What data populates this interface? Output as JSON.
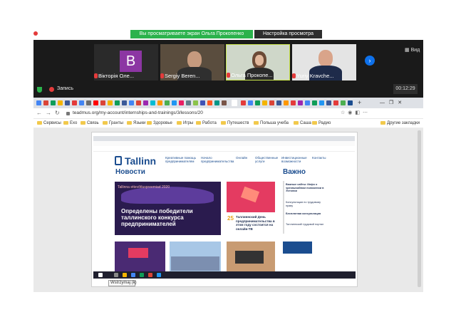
{
  "zoom": {
    "share_banner": "Вы просматриваете экран Ольга Прокопенко",
    "view_options": "Настройка просмотра",
    "participants": [
      {
        "avatar_letter": "B",
        "name": "Вікторія Оле..."
      },
      {
        "name": "Sergiy Beren..."
      },
      {
        "name": "Ольга Прокопе..."
      },
      {
        "name": "Yuriy Kravche..."
      }
    ],
    "view_label": "Вид",
    "record_label": "Запись",
    "timer": "00:12:29"
  },
  "browser": {
    "url": "teadmus.org/my-account/internships-and-trainings/3/lessons/20",
    "bookmarks": [
      "Сервисы",
      "Exo",
      "Связь",
      "Гранты",
      "Языки",
      "Здоровье",
      "Игры",
      "Работа",
      "Путешеств",
      "Польша учеба",
      "Саша",
      "Радио",
      "Другие закладки"
    ]
  },
  "shared_screen": {
    "logo": "Tallinn",
    "nav": [
      "Креативные помощь предпринимателям",
      "Начало предпринимательства",
      "Онлайн",
      "Общественные услуги",
      "Инвестиционные возможности",
      "Контакты"
    ],
    "news_title": "Новости",
    "important_title": "Важно",
    "hero_badge": "Tallinna ettevõtluspreemiad 2020",
    "hero_text": "Определены победители таллинского конкурса предпринимателей",
    "card2_date": "25",
    "card2_text": "Таллиннский День предпринимательства в этом году состоится на онлайн-ТВ",
    "important_items": [
      "Важные сайты: Инфо о чрезвычайном положении в Эстонии",
      "Консультации по трудовому праву",
      "Бесплатная консультация",
      "Таллиннский трудовой портал"
    ],
    "tooltip": "Wstrzymaj (k)"
  },
  "colors": {
    "zoom_green": "#2bb24c",
    "zoom_dark": "#1a1a1a",
    "tallinn_blue": "#1b4d8f",
    "record_red": "#e43b3b"
  }
}
